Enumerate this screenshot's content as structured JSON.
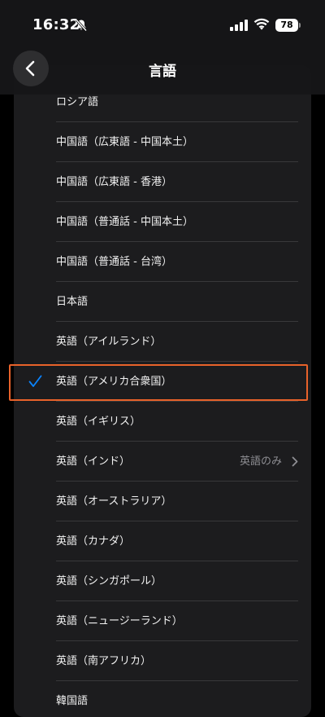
{
  "status_bar": {
    "time": "16:32",
    "battery": "78"
  },
  "nav": {
    "title": "言語"
  },
  "languages": [
    {
      "label": "ロシア語"
    },
    {
      "label": "中国語（広東語 - 中国本土）"
    },
    {
      "label": "中国語（広東語 - 香港）"
    },
    {
      "label": "中国語（普通話 - 中国本土）"
    },
    {
      "label": "中国語（普通話 - 台湾）"
    },
    {
      "label": "日本語"
    },
    {
      "label": "英語（アイルランド）"
    },
    {
      "label": "英語（アメリカ合衆国）",
      "selected": true
    },
    {
      "label": "英語（イギリス）"
    },
    {
      "label": "英語（インド）",
      "detail": "英語のみ"
    },
    {
      "label": "英語（オーストラリア）"
    },
    {
      "label": "英語（カナダ）"
    },
    {
      "label": "英語（シンガポール）"
    },
    {
      "label": "英語（ニュージーランド）"
    },
    {
      "label": "英語（南アフリカ）"
    },
    {
      "label": "韓国語"
    }
  ],
  "colors": {
    "checkmark": "#0a84ff",
    "highlight": "#e8622a"
  }
}
